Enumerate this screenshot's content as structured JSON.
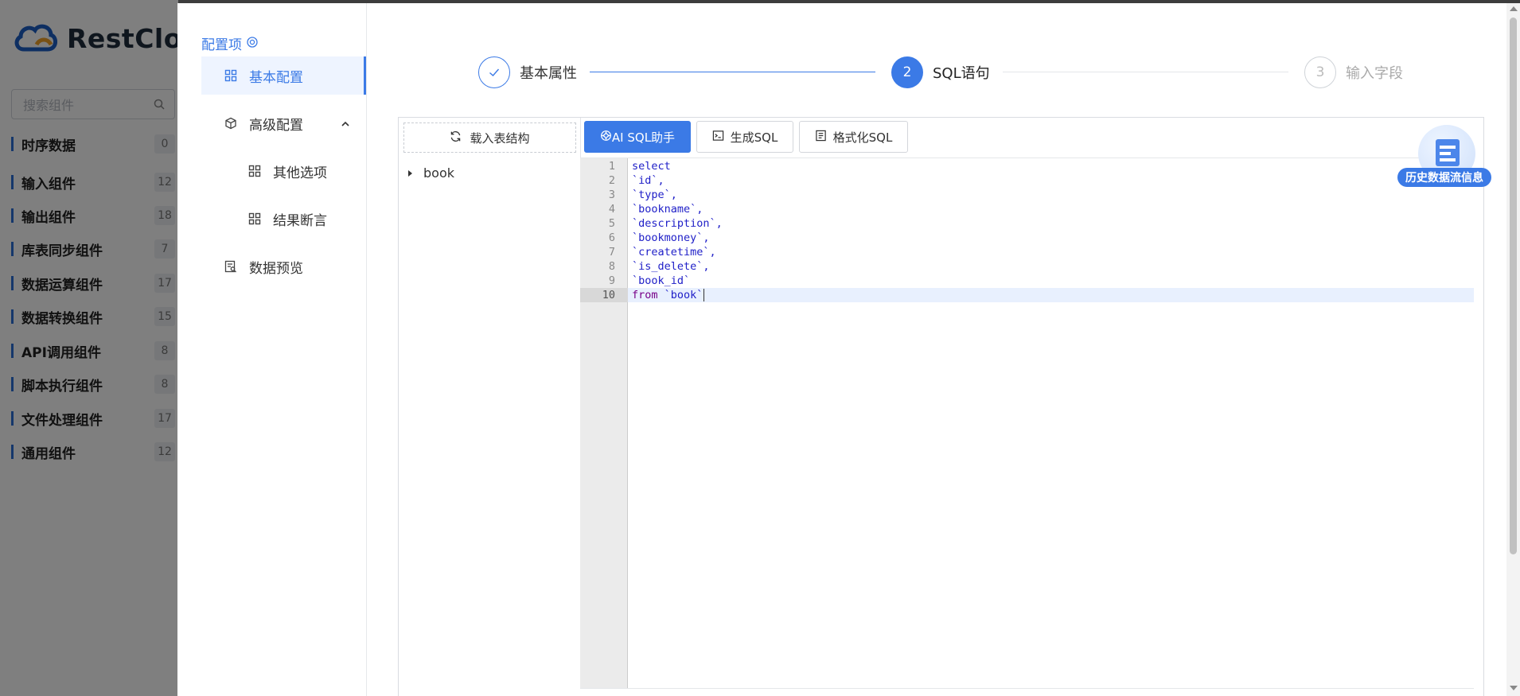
{
  "app": {
    "name": "RestCloud"
  },
  "sidebar": {
    "search_placeholder": "搜索组件",
    "categories": [
      {
        "label": "时序数据",
        "count": "0"
      },
      {
        "label": "输入组件",
        "count": "12"
      },
      {
        "label": "输出组件",
        "count": "18"
      },
      {
        "label": "库表同步组件",
        "count": "7"
      },
      {
        "label": "数据运算组件",
        "count": "17"
      },
      {
        "label": "数据转换组件",
        "count": "15"
      },
      {
        "label": "API调用组件",
        "count": "8"
      },
      {
        "label": "脚本执行组件",
        "count": "8"
      },
      {
        "label": "文件处理组件",
        "count": "17"
      },
      {
        "label": "通用组件",
        "count": "12"
      }
    ]
  },
  "config_nav": {
    "title": "配置项",
    "items": [
      {
        "label": "基本配置",
        "active": true
      },
      {
        "label": "高级配置",
        "expanded": true
      },
      {
        "label": "其他选项"
      },
      {
        "label": "结果断言"
      },
      {
        "label": "数据预览"
      }
    ]
  },
  "steps": [
    {
      "index": "1",
      "label": "基本属性",
      "status": "done"
    },
    {
      "index": "2",
      "label": "SQL语句",
      "status": "current"
    },
    {
      "index": "3",
      "label": "输入字段",
      "status": "pending"
    }
  ],
  "table_panel": {
    "load_button": "载入表结构",
    "tree": [
      {
        "label": "book"
      }
    ]
  },
  "toolbar": {
    "ai_button": "AI SQL助手",
    "generate_button": "生成SQL",
    "format_button": "格式化SQL"
  },
  "editor": {
    "lines": [
      {
        "no": "1",
        "text": "select"
      },
      {
        "no": "2",
        "text": "`id`,"
      },
      {
        "no": "3",
        "text": "`type`,"
      },
      {
        "no": "4",
        "text": "`bookname`,"
      },
      {
        "no": "5",
        "text": "`description`,"
      },
      {
        "no": "6",
        "text": "`bookmoney`,"
      },
      {
        "no": "7",
        "text": "`createtime`,"
      },
      {
        "no": "8",
        "text": "`is_delete`,"
      },
      {
        "no": "9",
        "text": "`book_id`"
      },
      {
        "no": "10",
        "text": "from `book`"
      }
    ],
    "active_line": "10"
  },
  "history": {
    "label": "历史数据流信息"
  },
  "colors": {
    "accent": "#3b7ae6",
    "keyword": "#770088",
    "identifier": "#2020c8"
  }
}
